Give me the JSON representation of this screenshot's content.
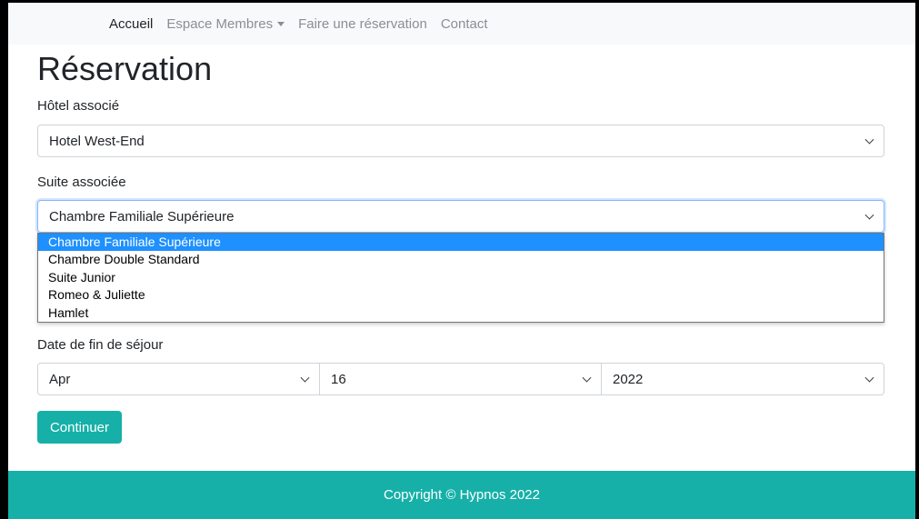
{
  "navbar": {
    "items": [
      {
        "label": "Accueil"
      },
      {
        "label": "Espace Membres"
      },
      {
        "label": "Faire une réservation"
      },
      {
        "label": "Contact"
      }
    ]
  },
  "page": {
    "title": "Réservation"
  },
  "form": {
    "hotel": {
      "label": "Hôtel associé",
      "value": "Hotel West-End"
    },
    "suite": {
      "label": "Suite associée",
      "value": "Chambre Familiale Supérieure",
      "options": [
        "Chambre Familiale Supérieure",
        "Chambre Double Standard",
        "Suite Junior",
        "Romeo & Juliette",
        "Hamlet"
      ]
    },
    "end_date": {
      "label": "Date de fin de séjour",
      "month": "Apr",
      "day": "16",
      "year": "2022"
    },
    "submit_label": "Continuer"
  },
  "footer": {
    "text": "Copyright © Hypnos 2022"
  },
  "colors": {
    "accent": "#17b0a8",
    "option_selected": "#1e90ff",
    "navbar_bg": "#f8f9fa"
  }
}
